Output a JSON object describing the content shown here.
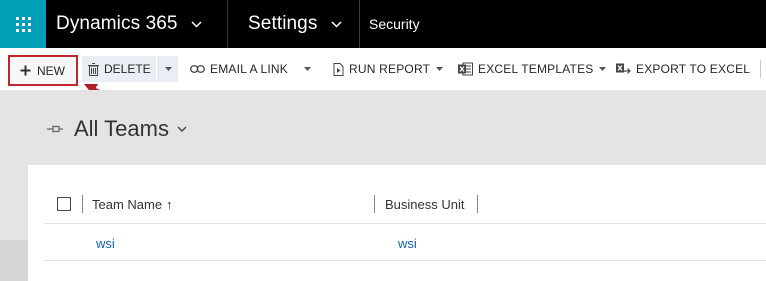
{
  "topbar": {
    "app_name": "Dynamics 365",
    "area_name": "Settings",
    "subarea_name": "Security",
    "app_icon": "waffle-icon",
    "colors": {
      "bar": "#000000",
      "waffle": "#009fb7"
    }
  },
  "commands": {
    "new_label": "NEW",
    "delete_label": "DELETE",
    "email_link_label": "EMAIL A LINK",
    "run_report_label": "RUN REPORT",
    "excel_templates_label": "EXCEL TEMPLATES",
    "export_excel_label": "EXPORT TO EXCEL",
    "highlight_color": "#c0272d"
  },
  "view": {
    "title": "All Teams"
  },
  "grid": {
    "columns": [
      "Team Name",
      "Business Unit"
    ],
    "sort_indicator": "↑",
    "rows": [
      {
        "team_name": "wsi",
        "business_unit": "wsi"
      }
    ],
    "link_color": "#1160b7"
  }
}
